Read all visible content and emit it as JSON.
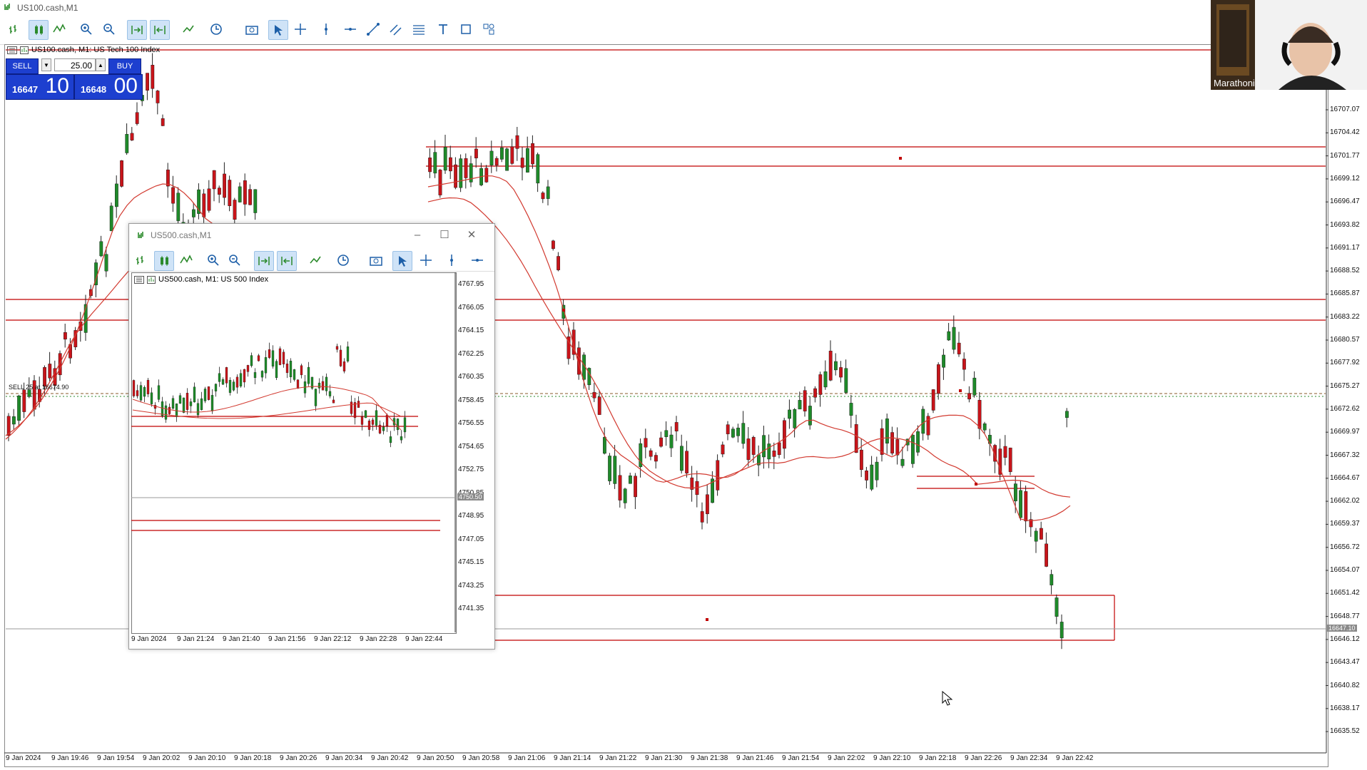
{
  "window": {
    "title": "US100.cash,M1"
  },
  "main_chart": {
    "label": "US100.cash, M1:  US Tech 100 Index",
    "trade_panel": {
      "sell_label": "SELL",
      "buy_label": "BUY",
      "volume": "25.00",
      "sell_price_small": "16647",
      "sell_price_big": "10",
      "buy_price_small": "16648",
      "buy_price_big": "00"
    },
    "order_line_label": "SELL 25 at 16674.90",
    "current_price_tag": "16647.10",
    "y_ticks": [
      "16707.07",
      "16704.42",
      "16701.77",
      "16699.12",
      "16696.47",
      "16693.82",
      "16691.17",
      "16688.52",
      "16685.87",
      "16683.22",
      "16680.57",
      "16677.92",
      "16675.27",
      "16672.62",
      "16669.97",
      "16667.32",
      "16664.67",
      "16662.02",
      "16659.37",
      "16656.72",
      "16654.07",
      "16651.42",
      "16648.77",
      "16646.12",
      "16643.47",
      "16640.82",
      "16638.17",
      "16635.52"
    ],
    "x_ticks": [
      "9 Jan 2024",
      "9 Jan 19:46",
      "9 Jan 19:54",
      "9 Jan 20:02",
      "9 Jan 20:10",
      "9 Jan 20:18",
      "9 Jan 20:26",
      "9 Jan 20:34",
      "9 Jan 20:42",
      "9 Jan 20:50",
      "9 Jan 20:58",
      "9 Jan 21:06",
      "9 Jan 21:14",
      "9 Jan 21:22",
      "9 Jan 21:30",
      "9 Jan 21:38",
      "9 Jan 21:46",
      "9 Jan 21:54",
      "9 Jan 22:02",
      "9 Jan 22:10",
      "9 Jan 22:18",
      "9 Jan 22:26",
      "9 Jan 22:34",
      "9 Jan 22:42"
    ]
  },
  "sub_window": {
    "title": "US500.cash,M1",
    "label": "US500.cash, M1:  US 500 Index",
    "current_price_tag": "4750.50",
    "y_ticks": [
      "4767.95",
      "4766.05",
      "4764.15",
      "4762.25",
      "4760.35",
      "4758.45",
      "4756.55",
      "4754.65",
      "4752.75",
      "4750.85",
      "4748.95",
      "4747.05",
      "4745.15",
      "4743.25",
      "4741.35"
    ],
    "x_ticks": [
      "9 Jan 2024",
      "9 Jan 21:24",
      "9 Jan 21:40",
      "9 Jan 21:56",
      "9 Jan 22:12",
      "9 Jan 22:28",
      "9 Jan 22:44"
    ]
  },
  "webcam": {
    "name": "Marathoni"
  },
  "colors": {
    "bull": "#1f8a2a",
    "bear": "#c8141a",
    "level": "#c00000",
    "ma": "#d23a30"
  }
}
